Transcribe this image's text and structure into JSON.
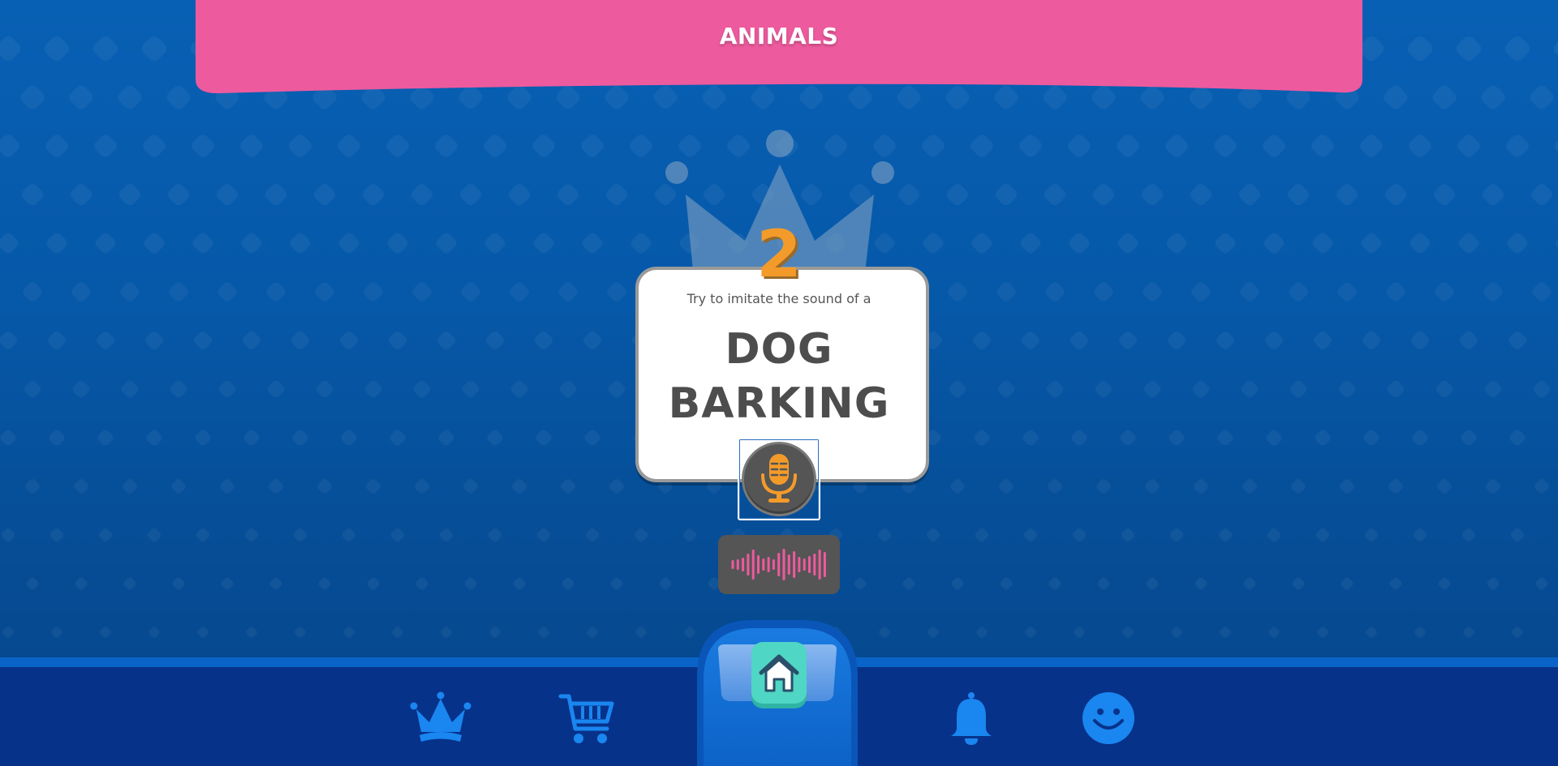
{
  "category": {
    "title": "ANIMALS"
  },
  "challenge": {
    "round_number": "2",
    "prompt": "Try to imitate the sound of a",
    "word_line_1": "DOG",
    "word_line_2": "BARKING"
  },
  "controls": {
    "mic_icon": "microphone-icon",
    "waveform_icon": "sound-wave-icon"
  },
  "nav": {
    "items": [
      {
        "icon": "crown-icon",
        "label": "leaderboard"
      },
      {
        "icon": "cart-icon",
        "label": "shop"
      },
      {
        "icon": "home-icon",
        "label": "home"
      },
      {
        "icon": "bell-icon",
        "label": "notifications"
      },
      {
        "icon": "smiley-icon",
        "label": "profile"
      }
    ]
  },
  "colors": {
    "banner": "#ee5a9e",
    "background": "#0660b3",
    "number": "#f39b2a",
    "mic": "#f39b2a",
    "wave": "#ee5a9e",
    "nav_icon": "#1a86f0",
    "home_button": "#4fd6c4"
  }
}
